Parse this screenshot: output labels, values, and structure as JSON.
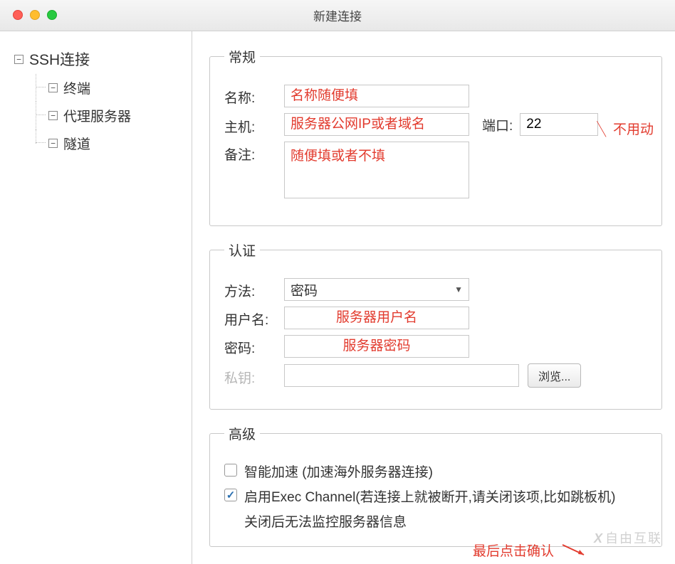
{
  "window": {
    "title": "新建连接"
  },
  "sidebar": {
    "root_label": "SSH连接",
    "items": [
      {
        "label": "终端"
      },
      {
        "label": "代理服务器"
      },
      {
        "label": "隧道"
      }
    ]
  },
  "general": {
    "legend": "常规",
    "name_label": "名称:",
    "name_placeholder": "名称随便填",
    "host_label": "主机:",
    "host_placeholder": "服务器公网IP或者域名",
    "port_label": "端口:",
    "port_value": "22",
    "port_note": "不用动",
    "remark_label": "备注:",
    "remark_placeholder": "随便填或者不填"
  },
  "auth": {
    "legend": "认证",
    "method_label": "方法:",
    "method_value": "密码",
    "username_label": "用户名:",
    "username_placeholder": "服务器用户名",
    "password_label": "密码:",
    "password_placeholder": "服务器密码",
    "privkey_label": "私钥:",
    "browse_label": "浏览..."
  },
  "advanced": {
    "legend": "高级",
    "accel_label": "智能加速 (加速海外服务器连接)",
    "accel_checked": false,
    "exec_label": "启用Exec Channel(若连接上就被断开,请关闭该项,比如跳板机)",
    "exec_sub": "关闭后无法监控服务器信息",
    "exec_checked": true
  },
  "footer": {
    "final_note": "最后点击确认"
  },
  "watermark": "自由互联"
}
